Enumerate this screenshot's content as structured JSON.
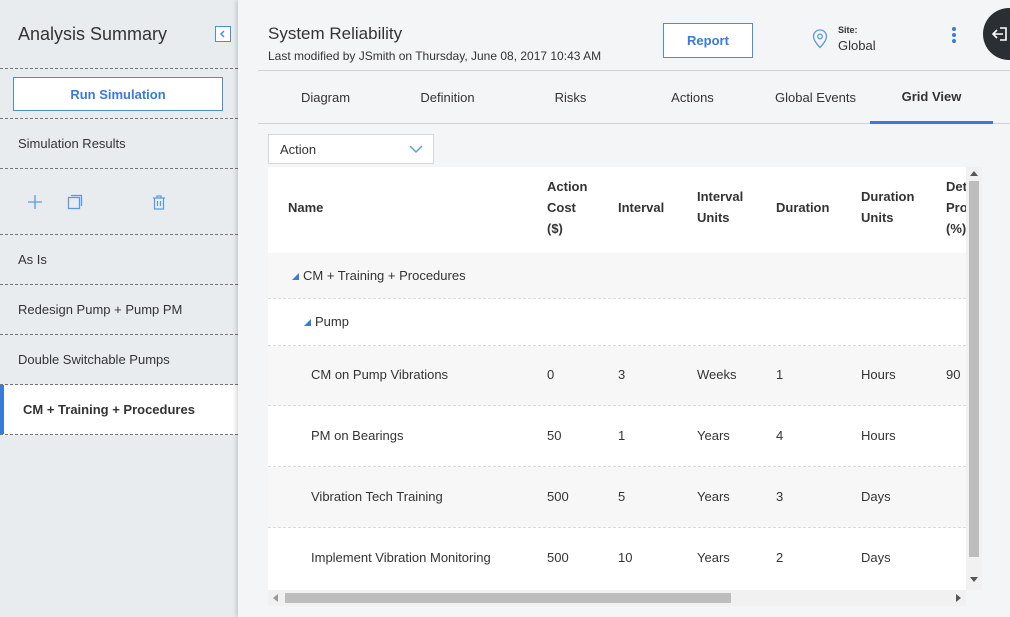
{
  "sidebar": {
    "title": "Analysis Summary",
    "run_button": "Run Simulation",
    "results_label": "Simulation Results",
    "tools": [
      "add-icon",
      "copy-icon",
      "trash-icon"
    ],
    "scenarios": [
      {
        "label": "As Is",
        "active": false
      },
      {
        "label": "Redesign Pump + Pump PM",
        "active": false
      },
      {
        "label": "Double Switchable Pumps",
        "active": false
      },
      {
        "label": "CM + Training + Procedures",
        "active": true
      }
    ]
  },
  "header": {
    "title": "System Reliability",
    "subtitle": "Last modified by JSmith on Thursday, June 08, 2017 10:43 AM",
    "report_button": "Report",
    "site_label": "Site:",
    "site_value": "Global"
  },
  "tabs": [
    {
      "label": "Diagram",
      "active": false
    },
    {
      "label": "Definition",
      "active": false
    },
    {
      "label": "Risks",
      "active": false
    },
    {
      "label": "Actions",
      "active": false
    },
    {
      "label": "Global Events",
      "active": false
    },
    {
      "label": "Grid View",
      "active": true
    }
  ],
  "filter": {
    "selected": "Action"
  },
  "grid": {
    "columns": [
      {
        "lines": [
          "Name"
        ]
      },
      {
        "lines": [
          "Action",
          "Cost",
          "($)"
        ]
      },
      {
        "lines": [
          "Interval"
        ]
      },
      {
        "lines": [
          "Interval",
          "Units"
        ]
      },
      {
        "lines": [
          "Duration"
        ]
      },
      {
        "lines": [
          "Duration",
          "Units"
        ]
      },
      {
        "lines": [
          "Det",
          "Pro",
          "(%)"
        ]
      }
    ],
    "group1": "CM + Training + Procedures",
    "group2": "Pump",
    "rows": [
      {
        "name": "CM on Pump Vibrations",
        "cost": "0",
        "interval": "3",
        "interval_units": "Weeks",
        "duration": "1",
        "duration_units": "Hours",
        "det": "90"
      },
      {
        "name": "PM on Bearings",
        "cost": "50",
        "interval": "1",
        "interval_units": "Years",
        "duration": "4",
        "duration_units": "Hours",
        "det": ""
      },
      {
        "name": "Vibration Tech Training",
        "cost": "500",
        "interval": "5",
        "interval_units": "Years",
        "duration": "3",
        "duration_units": "Days",
        "det": ""
      },
      {
        "name": "Implement Vibration Monitoring",
        "cost": "500",
        "interval": "10",
        "interval_units": "Years",
        "duration": "2",
        "duration_units": "Days",
        "det": ""
      }
    ]
  }
}
